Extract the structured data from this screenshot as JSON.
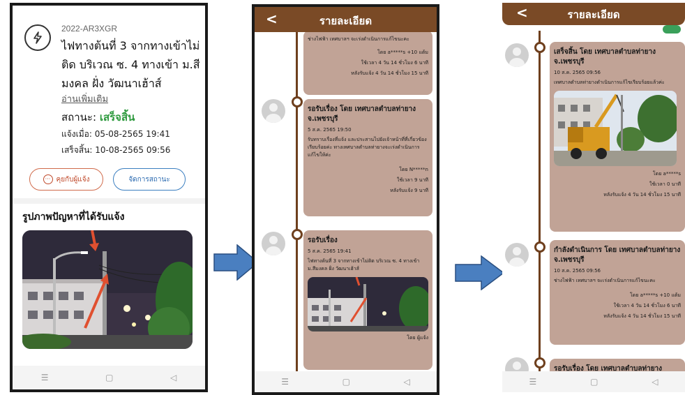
{
  "screen1": {
    "report_id": "2022-AR3XGR",
    "title": "ไฟทางต้นที่ 3 จากทางเข้าไม่ติด บริเวณ ซ. 4 ทางเข้า ม.สีมงคล ฝั่ง วัฒนาเฮ้าส์",
    "read_more": "อ่านเพิ่มเติม",
    "status_label": "สถานะ:",
    "status_value": "เสร็จสิ้น",
    "reported_at": "แจ้งเมื่อ: 05-08-2565 19:41",
    "finished_at": "เสร็จสิ้น: 10-08-2565 09:56",
    "chat_button": "คุยกับผู้แจ้ง",
    "manage_button": "จัดการสถานะ",
    "photos_heading": "รูปภาพปัญหาที่ได้รับแจ้ง",
    "status_color": "#2e9a3e"
  },
  "screen2": {
    "header_title": "รายละเอียด",
    "back": "<",
    "top_partial": {
      "body": "ช่างไฟฟ้า เทศบาลฯ จะเร่งดำเนินการแก้ไขนะคะ",
      "by": "โดย a*****s +10 แต้ม",
      "time": "ใช้เวลา 4 วัน 14 ชั่วโมง 6 นาที",
      "after": "หลังรับแจ้ง 4 วัน 14 ชั่วโมง 15 นาที"
    },
    "card_waiting_org": {
      "title": "รอรับเรื่อง โดย เทศบาลตำบลท่ายาง จ.เพชรบุรี",
      "date": "5 ส.ค. 2565 19:50",
      "body": "รับทราบเรื่องที่แจ้ง และประสานไปยังเจ้าหน้าที่ที่เกี่ยวข้องเรียบร้อยค่ะ ทางเทศบาลตำบลท่ายางจะเร่งดำเนินการแก้ไขให้ค่ะ",
      "by": "โดย N*****n",
      "time": "ใช้เวลา 9 นาที",
      "after": "หลังรับแจ้ง 9 นาที"
    },
    "card_waiting": {
      "title": "รอรับเรื่อง",
      "date": "5 ส.ค. 2565 19:41",
      "body": "ไฟทางต้นที่ 3 จากทางเข้าไม่ติด บริเวณ ซ. 4 ทางเข้า ม.สีมงคล ฝั่ง วัฒนาเฮ้าส์",
      "by": "โดย ผู้แจ้ง"
    }
  },
  "screen3": {
    "header_title": "รายละเอียด",
    "back": "<",
    "card_done": {
      "title": "เสร็จสิ้น โดย เทศบาลตำบลท่ายาง จ.เพชรบุรี",
      "date": "10 ส.ค. 2565 09:56",
      "body": "เทศบาลตำบลท่ายางดำเนินการแก้ไขเรียบร้อยแล้วค่ะ",
      "by": "โดย a*****s",
      "time": "ใช้เวลา 0 นาที",
      "after": "หลังรับแจ้ง 4 วัน 14 ชั่วโมง 15 นาที"
    },
    "card_inprogress": {
      "title": "กำลังดำเนินการ โดย เทศบาลตำบลท่ายาง จ.เพชรบุรี",
      "date": "10 ส.ค. 2565 09:56",
      "body": "ช่างไฟฟ้า เทศบาลฯ จะเร่งดำเนินการแก้ไขนะคะ",
      "by": "โดย a*****s +10 แต้ม",
      "time": "ใช้เวลา 4 วัน 14 ชั่วโมง 6 นาที",
      "after": "หลังรับแจ้ง 4 วัน 14 ชั่วโมง 15 นาที"
    },
    "card_partial_title": "รอรับเรื่อง โดย เทศบาลตำบลท่ายาง"
  },
  "colors": {
    "header_brown": "#7a4a26",
    "card_bg": "#c1a396",
    "arrow_blue": "#4a7fc0",
    "timeline": "#6e3f1d"
  }
}
